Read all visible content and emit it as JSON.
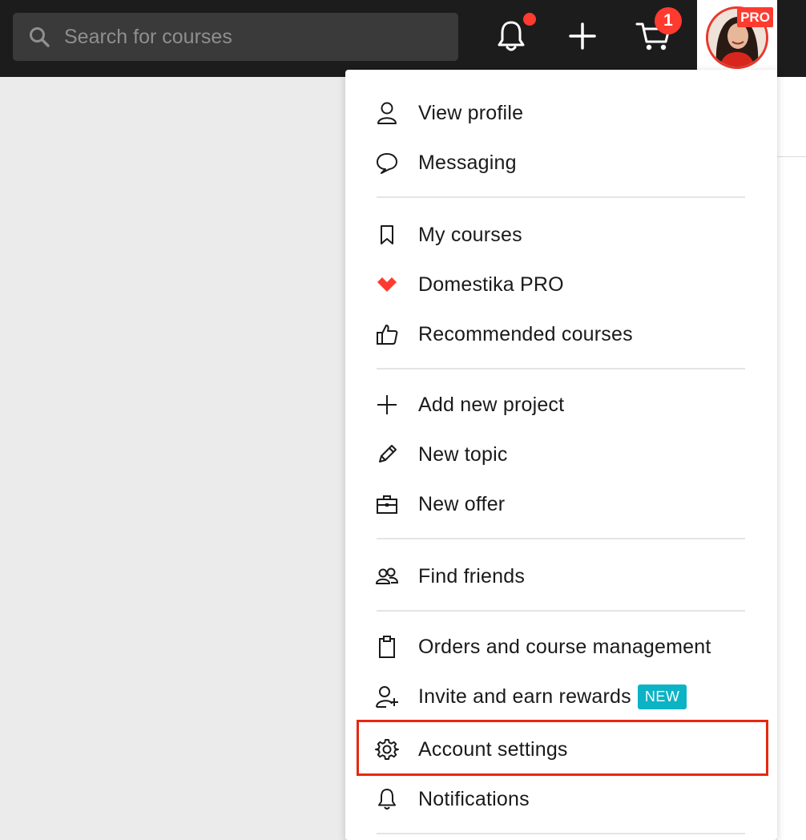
{
  "search": {
    "placeholder": "Search for courses",
    "icon": "search-icon"
  },
  "header": {
    "cart_count": "1",
    "pro_label": "PRO",
    "icons": [
      "bell-icon",
      "plus-icon",
      "cart-icon"
    ]
  },
  "menu": {
    "sections": [
      [
        {
          "label": "View profile",
          "icon": "user-icon"
        },
        {
          "label": "Messaging",
          "icon": "chat-bubble-icon"
        }
      ],
      [
        {
          "label": "My courses",
          "icon": "bookmark-icon"
        },
        {
          "label": "Domestika PRO",
          "icon": "domestika-logo-icon"
        },
        {
          "label": "Recommended courses",
          "icon": "thumbs-up-icon"
        }
      ],
      [
        {
          "label": "Add new project",
          "icon": "plus-icon"
        },
        {
          "label": "New topic",
          "icon": "pencil-icon"
        },
        {
          "label": "New offer",
          "icon": "briefcase-icon"
        }
      ],
      [
        {
          "label": "Find friends",
          "icon": "friends-icon"
        }
      ],
      [
        {
          "label": "Orders and course management",
          "icon": "clipboard-icon"
        },
        {
          "label": "Invite and earn rewards",
          "icon": "add-user-icon",
          "badge": "NEW"
        },
        {
          "label": "Account settings",
          "icon": "gear-icon",
          "highlighted": true
        },
        {
          "label": "Notifications",
          "icon": "bell-icon"
        }
      ]
    ]
  },
  "colors": {
    "accent": "#ff3b2f",
    "new_badge": "#0bb3c5",
    "highlight_border": "#e8270f",
    "topbar": "#1c1c1c"
  }
}
